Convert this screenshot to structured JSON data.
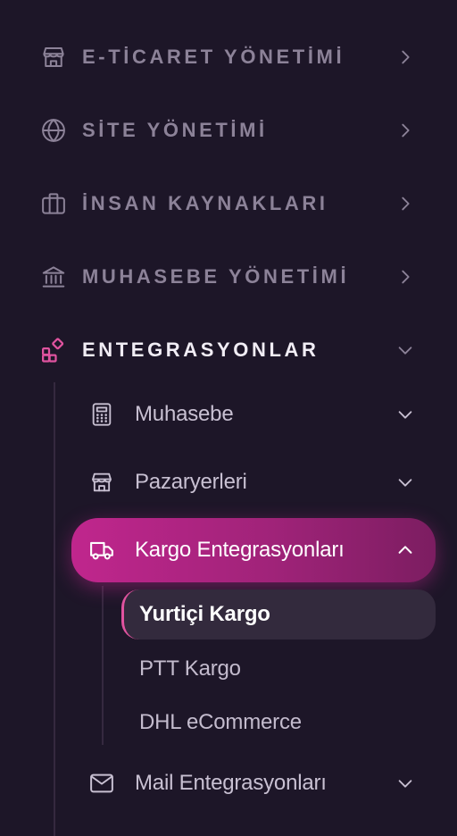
{
  "sections": [
    {
      "label": "E-TİCARET YÖNETİMİ",
      "icon": "store-icon",
      "expanded": false
    },
    {
      "label": "SİTE YÖNETİMİ",
      "icon": "globe-icon",
      "expanded": false
    },
    {
      "label": "İNSAN KAYNAKLARI",
      "icon": "briefcase-icon",
      "expanded": false
    },
    {
      "label": "MUHASEBE YÖNETİMİ",
      "icon": "bank-icon",
      "expanded": false
    },
    {
      "label": "ENTEGRASYONLAR",
      "icon": "integrations-icon",
      "expanded": true
    }
  ],
  "integrations": {
    "items": [
      {
        "label": "Muhasebe",
        "icon": "calculator-icon",
        "expanded": false
      },
      {
        "label": "Pazaryerleri",
        "icon": "store-icon",
        "expanded": false
      },
      {
        "label": "Kargo Entegrasyonları",
        "icon": "truck-icon",
        "expanded": true,
        "active": true
      },
      {
        "label": "Mail Entegrasyonları",
        "icon": "mail-icon",
        "expanded": false
      }
    ],
    "cargo_items": [
      {
        "label": "Yurtiçi Kargo",
        "active": true
      },
      {
        "label": "PTT Kargo",
        "active": false
      },
      {
        "label": "DHL eCommerce",
        "active": false
      }
    ]
  },
  "colors": {
    "background": "#1d1628",
    "accent": "#c0268d",
    "accent_icon": "#e0539f",
    "muted_text": "#8c8298"
  }
}
